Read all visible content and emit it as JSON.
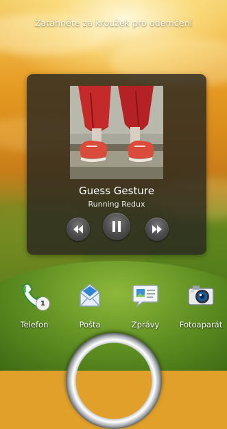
{
  "lockscreen": {
    "hint_text": "Zatáhněte za kroužek pro odemčení"
  },
  "music_player": {
    "track_title": "Guess Gesture",
    "artist": "Running Redux",
    "controls": {
      "previous_icon": "rewind-icon",
      "play_pause_icon": "pause-icon",
      "next_icon": "fast-forward-icon"
    }
  },
  "dock": {
    "items": [
      {
        "label": "Telefon",
        "icon": "phone-icon",
        "badge": "1"
      },
      {
        "label": "Pošta",
        "icon": "mail-icon"
      },
      {
        "label": "Zprávy",
        "icon": "messages-icon"
      },
      {
        "label": "Fotoaparát",
        "icon": "camera-icon"
      }
    ]
  },
  "unlock": {
    "icon": "unlock-ring-icon"
  }
}
